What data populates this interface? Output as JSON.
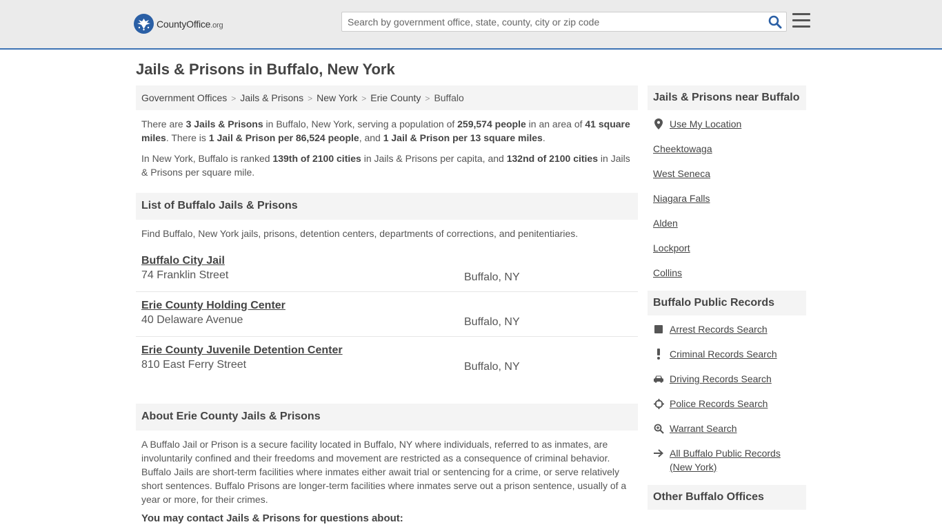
{
  "header": {
    "logo_main": "CountyOffice",
    "logo_suffix": ".org",
    "search_placeholder": "Search by government office, state, county, city or zip code"
  },
  "page_title": "Jails & Prisons in Buffalo, New York",
  "breadcrumb": [
    "Government Offices",
    "Jails & Prisons",
    "New York",
    "Erie County",
    "Buffalo"
  ],
  "summary": {
    "p1_a": "There are ",
    "p1_b": "3 Jails & Prisons",
    "p1_c": " in Buffalo, New York, serving a population of ",
    "p1_d": "259,574 people",
    "p1_e": " in an area of ",
    "p1_f": "41 square miles",
    "p1_g": ". There is ",
    "p1_h": "1 Jail & Prison per 86,524 people",
    "p1_i": ", and ",
    "p1_j": "1 Jail & Prison per 13 square miles",
    "p1_k": ".",
    "p2_a": "In New York, Buffalo is ranked ",
    "p2_b": "139th of 2100 cities",
    "p2_c": " in Jails & Prisons per capita, and ",
    "p2_d": "132nd of 2100 cities",
    "p2_e": " in Jails & Prisons per square mile."
  },
  "list_section": {
    "title": "List of Buffalo Jails & Prisons",
    "intro": "Find Buffalo, New York jails, prisons, detention centers, departments of corrections, and penitentiaries.",
    "items": [
      {
        "name": "Buffalo City Jail",
        "address": "74 Franklin Street",
        "city": "Buffalo, NY"
      },
      {
        "name": "Erie County Holding Center",
        "address": "40 Delaware Avenue",
        "city": "Buffalo, NY"
      },
      {
        "name": "Erie County Juvenile Detention Center",
        "address": "810 East Ferry Street",
        "city": "Buffalo, NY"
      }
    ]
  },
  "about_section": {
    "title": "About Erie County Jails & Prisons",
    "text": "A Buffalo Jail or Prison is a secure facility located in Buffalo, NY where individuals, referred to as inmates, are involuntarily confined and their freedoms and movement are restricted as a consequence of criminal behavior. Buffalo Jails are short-term facilities where inmates either await trial or sentencing for a crime, or serve relatively short sentences. Buffalo Prisons are longer-term facilities where inmates serve out a prison sentence, usually of a year or more, for their crimes.",
    "contact_head": "You may contact Jails & Prisons for questions about:"
  },
  "sidebar": {
    "near_title": "Jails & Prisons near Buffalo",
    "use_location": "Use My Location",
    "near_items": [
      "Cheektowaga",
      "West Seneca",
      "Niagara Falls",
      "Alden",
      "Lockport",
      "Collins"
    ],
    "records_title": "Buffalo Public Records",
    "records": [
      {
        "label": "Arrest Records Search",
        "icon": "square-icon"
      },
      {
        "label": "Criminal Records Search",
        "icon": "exclamation-icon"
      },
      {
        "label": "Driving Records Search",
        "icon": "car-icon"
      },
      {
        "label": "Police Records Search",
        "icon": "crosshair-icon"
      },
      {
        "label": "Warrant Search",
        "icon": "magnify-icon"
      },
      {
        "label": "All Buffalo Public Records (New York)",
        "icon": "arrow-right-icon"
      }
    ],
    "other_title": "Other Buffalo Offices"
  },
  "colors": {
    "brand_blue": "#2a5fa5",
    "header_border": "#3d73b4",
    "panel_bg": "#f4f4f4"
  }
}
